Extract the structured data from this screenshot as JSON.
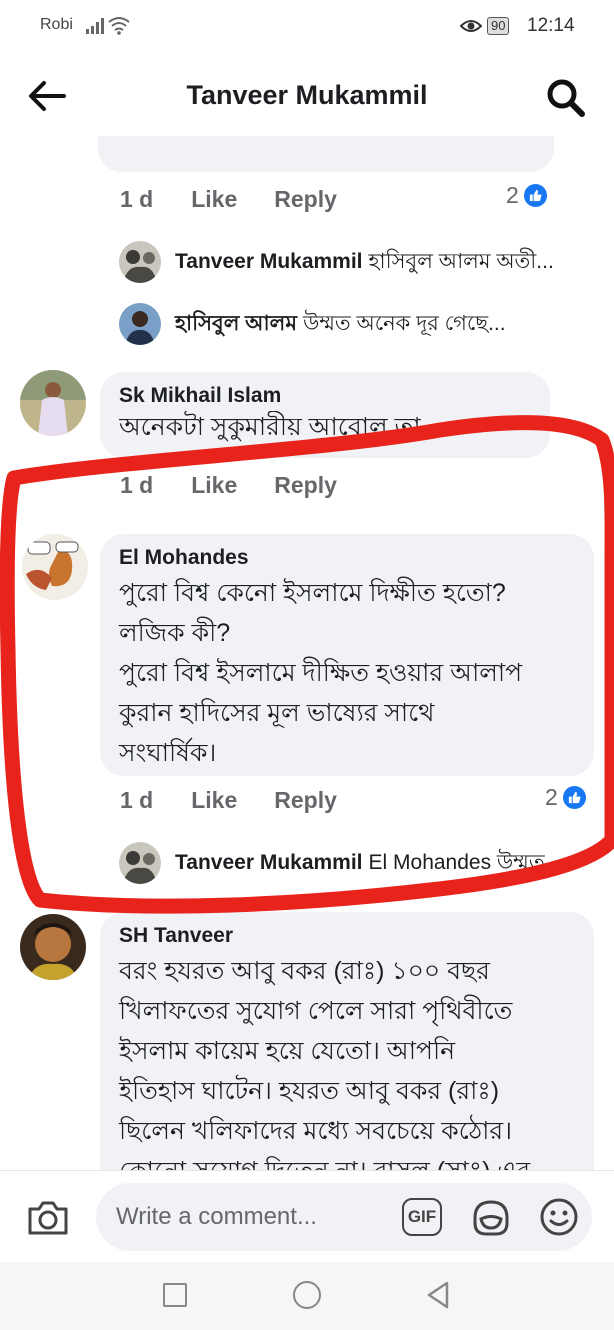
{
  "status_bar": {
    "carrier": "Robi",
    "battery": "90",
    "time": "12:14"
  },
  "header": {
    "title": "Tanveer Mukammil"
  },
  "thread_top": {
    "actions": {
      "time": "1 d",
      "like": "Like",
      "reply": "Reply"
    },
    "reaction_count": "2",
    "replies": [
      {
        "name": "Tanveer Mukammil",
        "text": "হাসিবুল আলম অতী..."
      },
      {
        "name": "হাসিবুল আলম",
        "text": "উম্মত অনেক দূর গেছে..."
      }
    ]
  },
  "comments": [
    {
      "name": "Sk Mikhail Islam",
      "text": "অনেকটা সুকুমারীয় আবোল তা",
      "actions": {
        "time": "1 d",
        "like": "Like",
        "reply": "Reply"
      }
    },
    {
      "name": "El Mohandes",
      "lines": [
        "পুরো বিশ্ব কেনো ইসলামে দিক্ষীত হতো?",
        "লজিক কী?",
        "পুরো বিশ্ব ইসলামে দীক্ষিত হওয়ার আলাপ",
        "কুরান হাদিসের মূল ভাষ্যের সাথে",
        "সংঘার্ষিক।"
      ],
      "actions": {
        "time": "1 d",
        "like": "Like",
        "reply": "Reply"
      },
      "reaction_count": "2",
      "reply": {
        "name": "Tanveer Mukammil",
        "text": "El Mohandes উম্মত"
      }
    },
    {
      "name": "SH Tanveer",
      "lines": [
        "বরং হযরত আবু বকর (রাঃ) ১০০ বছর",
        "খিলাফতের সুযোগ পেলে সারা পৃথিবীতে",
        "ইসলাম কায়েম হয়ে যেতো। আপনি",
        "ইতিহাস ঘাটেন। হযরত আবু বকর (রাঃ)",
        "ছিলেন খলিফাদের মধ্যে সবচেয়ে কঠোর।",
        "কোনো সুযোগ দিতেন না। রাসুল (সাঃ) এর"
      ]
    }
  ],
  "composer": {
    "placeholder": "Write a comment...",
    "gif_label": "GIF"
  },
  "colors": {
    "accent_blue": "#1877f2",
    "bubble_bg": "#f0f2f5",
    "annotation_red": "#e8231b"
  }
}
